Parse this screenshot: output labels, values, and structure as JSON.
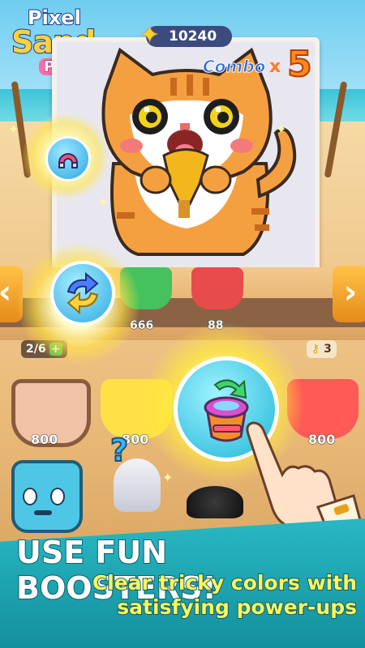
{
  "logo": {
    "line1": "Pixel",
    "line2": "Sand",
    "line3": "Puzzle"
  },
  "score": {
    "value": "10240",
    "icon": "star-icon"
  },
  "combo": {
    "label": "Combo",
    "multiplier_sign": "x",
    "value": "5"
  },
  "shelf": {
    "left_arrow": "›",
    "right_arrow": "›",
    "cups": [
      {
        "count": "666",
        "color": "#45c15d"
      },
      {
        "count": "88",
        "color": "#e84b4b"
      }
    ]
  },
  "counters": {
    "slots": "2/6",
    "plus": "+",
    "keys": "3",
    "key_icon": "key-icon"
  },
  "bottom_cups": [
    {
      "count": "800",
      "color": "#f2c2a6"
    },
    {
      "count": "800",
      "color": "#ffe046"
    },
    {
      "count": "800",
      "color": "#ff5a55"
    }
  ],
  "boosters": [
    {
      "name": "magnet-booster",
      "icon": "magnet-icon"
    },
    {
      "name": "shuffle-booster",
      "icon": "shuffle-icon"
    },
    {
      "name": "swap-cup-booster",
      "icon": "swap-cup-icon"
    }
  ],
  "banner": {
    "title": "USE FUN BOOSTERS!",
    "subtitle_line1": "Clear tricky colors with",
    "subtitle_line2": "satisfying power-ups"
  },
  "colors": {
    "accent": "#ffd23f",
    "banner": "#20a9b6",
    "subtitle": "#fff65c"
  }
}
